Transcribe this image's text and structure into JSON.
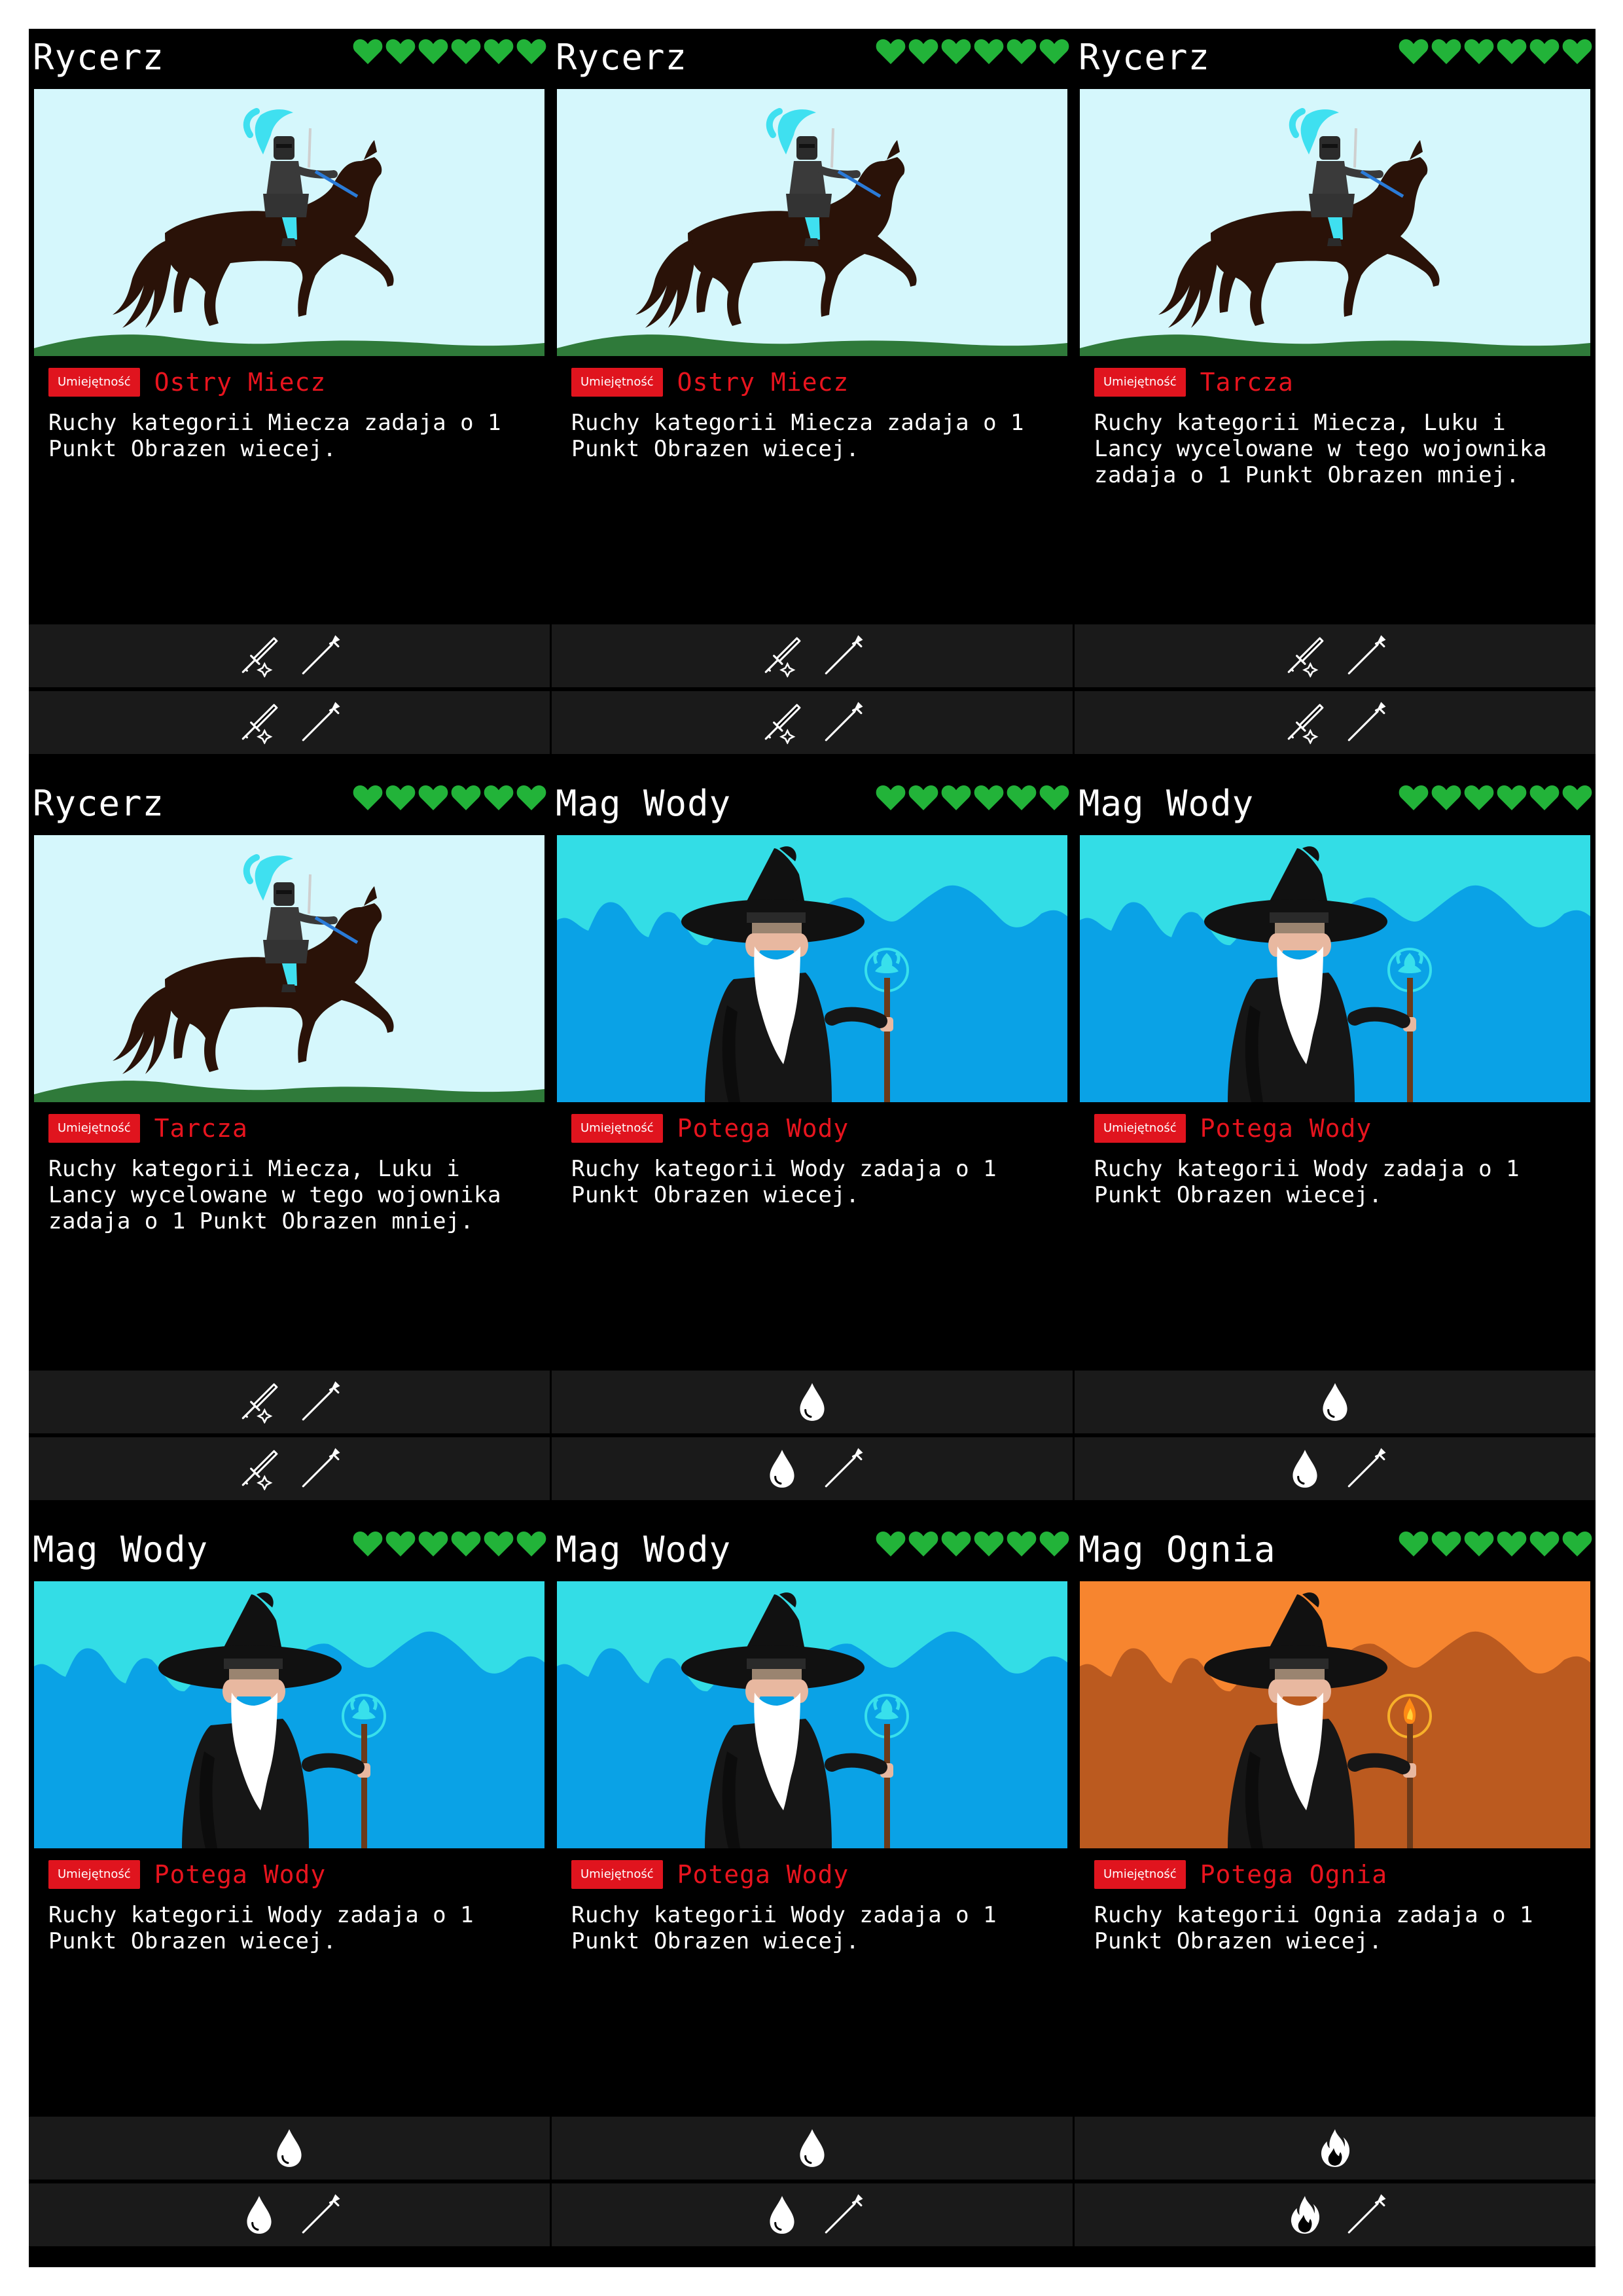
{
  "ability_badge_label": "Umiejętność",
  "colors": {
    "heart": "#22b339",
    "ability_badge": "#e0141e",
    "ability_name": "#e8141e",
    "text": "#ffffff",
    "card_bg": "#000000",
    "move_bar_bg": "#1a1a1a"
  },
  "cards": [
    {
      "name": "Rycerz",
      "hearts": 6,
      "art": "knight",
      "ability": {
        "badge": "Umiejętność",
        "name": "Ostry Miecz",
        "description": "Ruchy kategorii Miecza zadaja o 1 Punkt Obrazen wiecej."
      },
      "moves": [
        [
          "sword-icon",
          "spear-icon"
        ],
        [
          "sword-icon",
          "spear-icon"
        ]
      ]
    },
    {
      "name": "Rycerz",
      "hearts": 6,
      "art": "knight",
      "ability": {
        "badge": "Umiejętność",
        "name": "Ostry Miecz",
        "description": "Ruchy kategorii Miecza zadaja o 1 Punkt Obrazen wiecej."
      },
      "moves": [
        [
          "sword-icon",
          "spear-icon"
        ],
        [
          "sword-icon",
          "spear-icon"
        ]
      ]
    },
    {
      "name": "Rycerz",
      "hearts": 6,
      "art": "knight",
      "ability": {
        "badge": "Umiejętność",
        "name": "Tarcza",
        "description": "Ruchy kategorii Miecza, Luku i Lancy wycelowane w tego wojownika zadaja o 1 Punkt Obrazen mniej."
      },
      "moves": [
        [
          "sword-icon",
          "spear-icon"
        ],
        [
          "sword-icon",
          "spear-icon"
        ]
      ]
    },
    {
      "name": "Rycerz",
      "hearts": 6,
      "art": "knight",
      "ability": {
        "badge": "Umiejętność",
        "name": "Tarcza",
        "description": "Ruchy kategorii Miecza, Luku i Lancy wycelowane w tego wojownika zadaja o 1 Punkt Obrazen mniej."
      },
      "moves": [
        [
          "sword-icon",
          "spear-icon"
        ],
        [
          "sword-icon",
          "spear-icon"
        ]
      ]
    },
    {
      "name": "Mag Wody",
      "hearts": 6,
      "art": "water-mage",
      "ability": {
        "badge": "Umiejętność",
        "name": "Potega Wody",
        "description": "Ruchy kategorii Wody zadaja o 1 Punkt Obrazen wiecej."
      },
      "moves": [
        [
          "water-drop-icon"
        ],
        [
          "water-drop-icon",
          "spear-icon"
        ]
      ]
    },
    {
      "name": "Mag Wody",
      "hearts": 6,
      "art": "water-mage",
      "ability": {
        "badge": "Umiejętność",
        "name": "Potega Wody",
        "description": "Ruchy kategorii Wody zadaja o 1 Punkt Obrazen wiecej."
      },
      "moves": [
        [
          "water-drop-icon"
        ],
        [
          "water-drop-icon",
          "spear-icon"
        ]
      ]
    },
    {
      "name": "Mag Wody",
      "hearts": 6,
      "art": "water-mage",
      "ability": {
        "badge": "Umiejętność",
        "name": "Potega Wody",
        "description": "Ruchy kategorii Wody zadaja o 1 Punkt Obrazen wiecej."
      },
      "moves": [
        [
          "water-drop-icon"
        ],
        [
          "water-drop-icon",
          "spear-icon"
        ]
      ]
    },
    {
      "name": "Mag Wody",
      "hearts": 6,
      "art": "water-mage",
      "ability": {
        "badge": "Umiejętność",
        "name": "Potega Wody",
        "description": "Ruchy kategorii Wody zadaja o 1 Punkt Obrazen wiecej."
      },
      "moves": [
        [
          "water-drop-icon"
        ],
        [
          "water-drop-icon",
          "spear-icon"
        ]
      ]
    },
    {
      "name": "Mag Ognia",
      "hearts": 6,
      "art": "fire-mage",
      "ability": {
        "badge": "Umiejętność",
        "name": "Potega Ognia",
        "description": "Ruchy kategorii Ognia zadaja o 1 Punkt Obrazen wiecej."
      },
      "moves": [
        [
          "fire-icon"
        ],
        [
          "fire-icon",
          "spear-icon"
        ]
      ]
    }
  ]
}
